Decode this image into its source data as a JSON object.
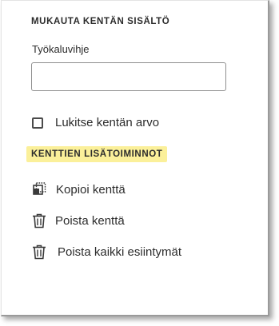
{
  "panel": {
    "customize_heading": "MUKAUTA KENTÄN SISÄLTÖ",
    "tooltip_label": "Työkaluvihje",
    "tooltip_value": "",
    "lock_label": "Lukitse kentän arvo",
    "lock_checked": false,
    "more_heading": "KENTTIEN LISÄTOIMINNOT",
    "more_heading_highlight": "#fbf09a",
    "actions": [
      {
        "label": "Kopioi kenttä",
        "icon": "copy-field-icon"
      },
      {
        "label": "Poista kenttä",
        "icon": "trash-icon"
      },
      {
        "label": "Poista kaikki esiintymät",
        "icon": "trash-icon"
      }
    ]
  }
}
